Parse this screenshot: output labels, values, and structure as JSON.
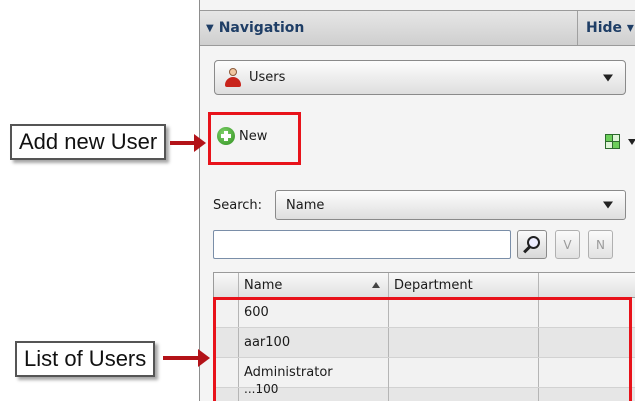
{
  "panel": {
    "title": "Navigation",
    "hide_label": "Hide ▾"
  },
  "module_select": {
    "value": "Users",
    "icon": "user-icon"
  },
  "toolbar": {
    "new_label": "New",
    "new_icon": "add-plus-icon",
    "view_icon": "view-grid-icon"
  },
  "search": {
    "label": "Search:",
    "field_value": "Name",
    "input_value": "",
    "v_label": "V",
    "n_label": "N"
  },
  "grid": {
    "columns": [
      "Name",
      "Department"
    ],
    "rows": [
      {
        "name": "600",
        "department": ""
      },
      {
        "name": "aar100",
        "department": ""
      },
      {
        "name": "Administrator",
        "department": ""
      },
      {
        "name": "...100",
        "department": ""
      }
    ]
  },
  "annotations": {
    "add_user": "Add new User",
    "list_users": "List of Users"
  },
  "colors": {
    "highlight": "#e8121a",
    "arrow": "#b31218",
    "header_text": "#1f3e66",
    "icon_green": "#2f8f1f"
  }
}
